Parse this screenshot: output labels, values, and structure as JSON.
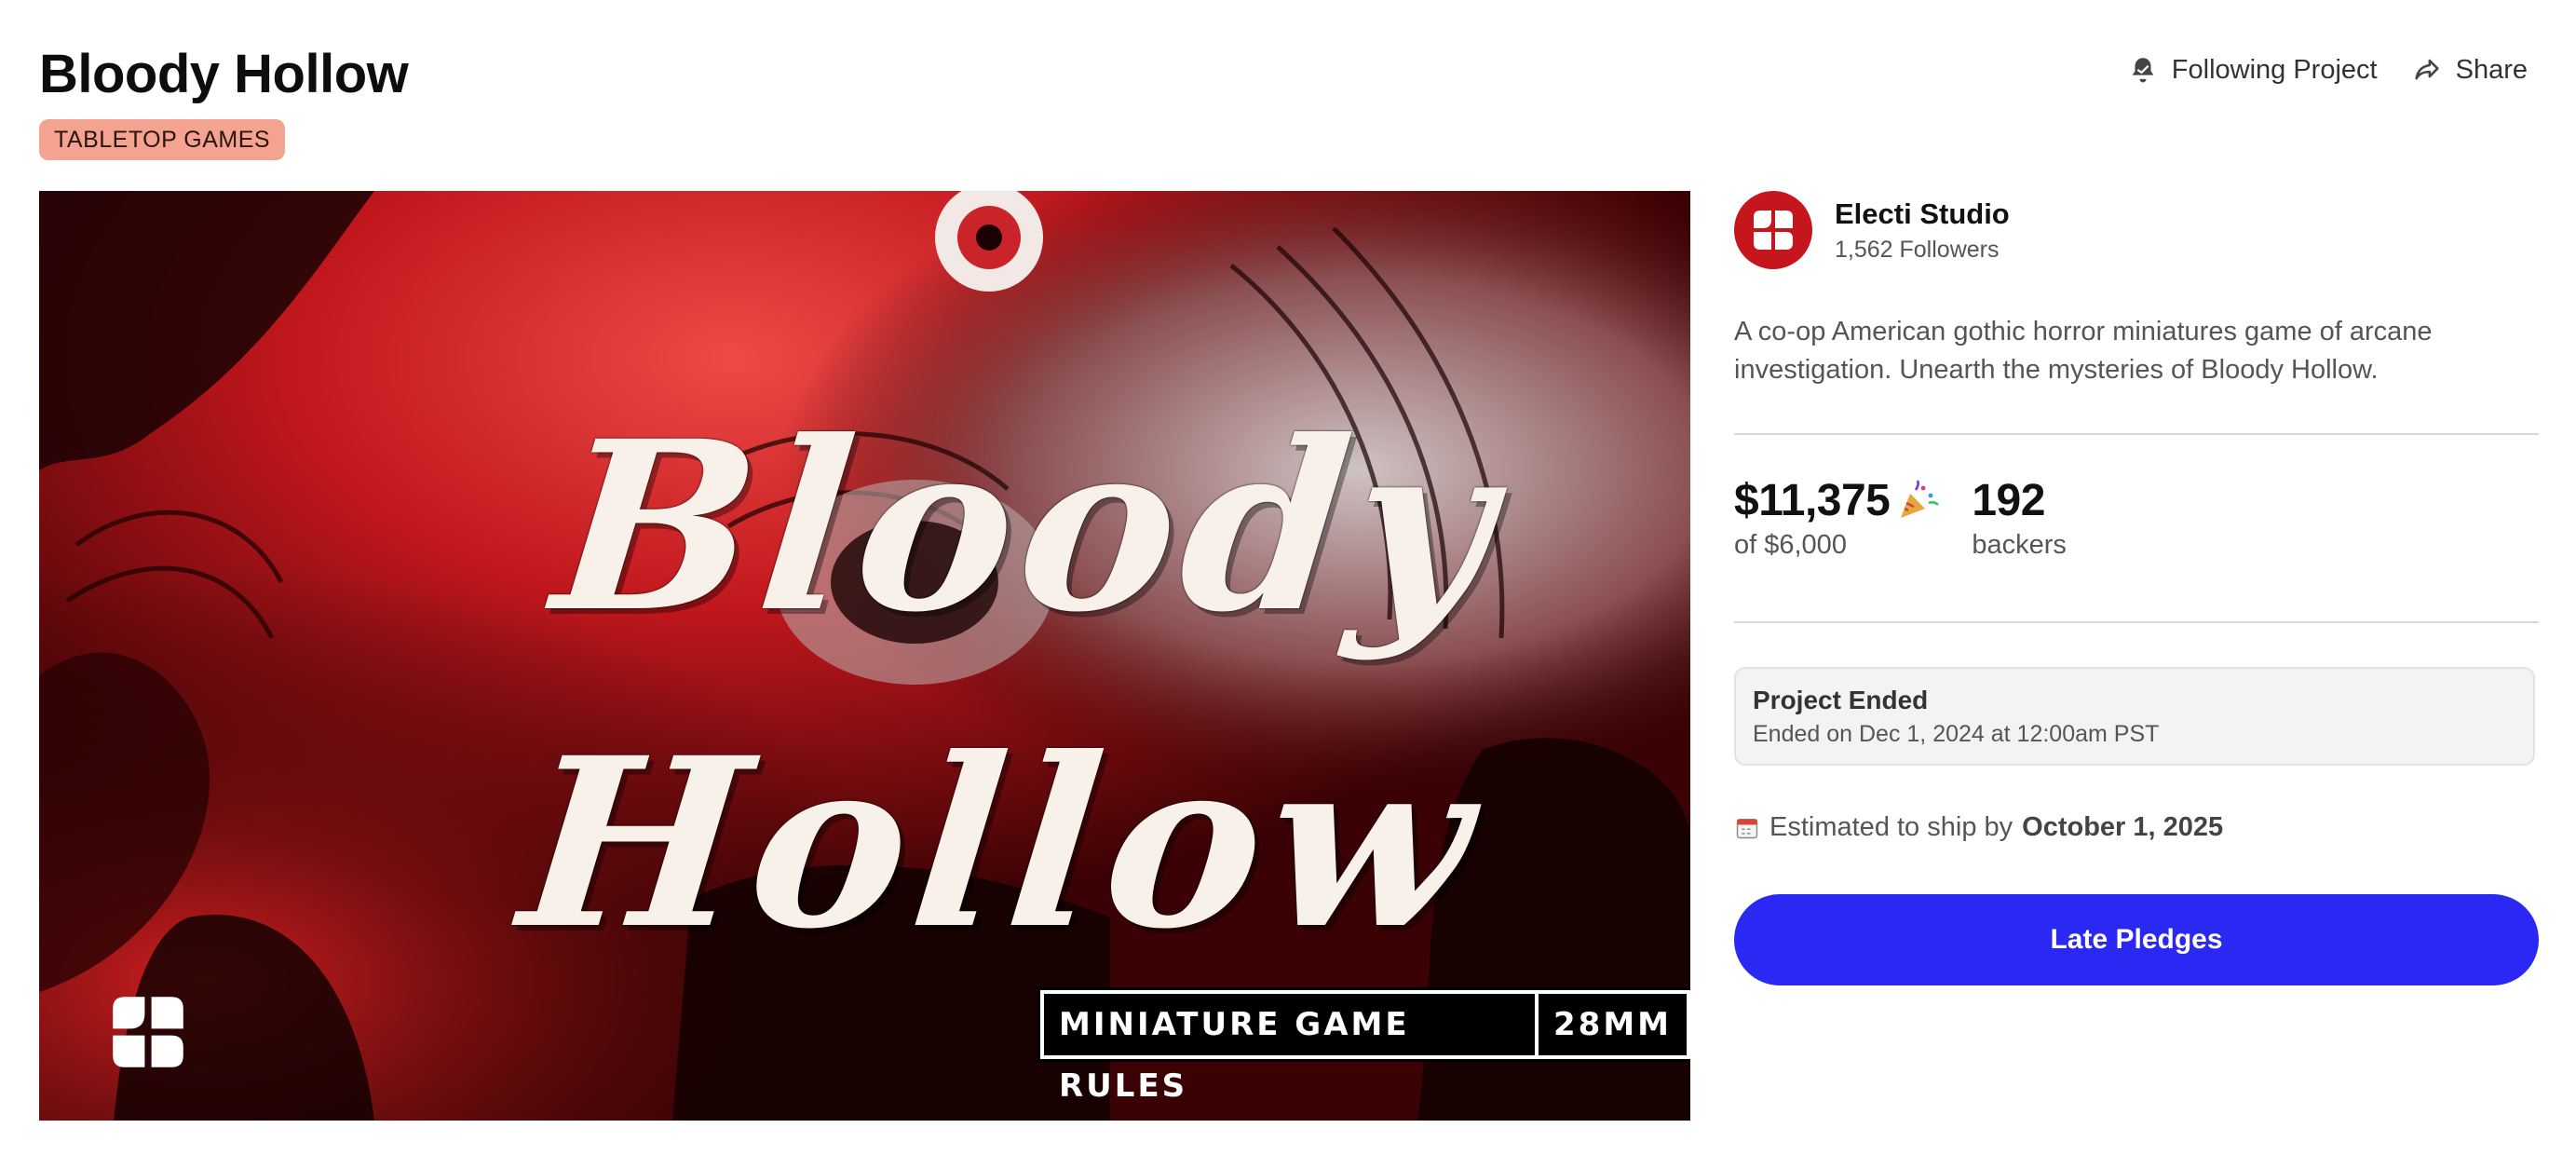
{
  "project": {
    "title": "Bloody Hollow",
    "category": "TABLETOP GAMES"
  },
  "actions": {
    "follow_label": "Following Project",
    "share_label": "Share",
    "follow_icon": "bell-icon",
    "share_icon": "share-arrow-icon"
  },
  "hero": {
    "title_line1": "Bloody",
    "title_line2": "Hollow",
    "badge_rules": "MINIATURE GAME RULES",
    "badge_scale": "28MM",
    "logo_icon": "electi-studio-logo-icon",
    "colors": {
      "primary": "#c5161e",
      "dark": "#1a0203"
    }
  },
  "creator": {
    "name": "Electi Studio",
    "followers": "1,562 Followers"
  },
  "blurb": "A co-op American gothic horror miniatures game of arcane investigation. Unearth the mysteries of Bloody Hollow.",
  "stats": {
    "pledged": "$11,375",
    "pledged_icon": "party-popper-icon",
    "goal": "of $6,000",
    "backers": "192",
    "backers_label": "backers"
  },
  "status": {
    "title": "Project Ended",
    "subtitle": "Ended on Dec 1, 2024 at 12:00am PST"
  },
  "shipping": {
    "icon": "calendar-icon",
    "prefix": "Estimated to ship by",
    "date": "October 1, 2025"
  },
  "cta": {
    "label": "Late Pledges",
    "color": "#2b28f4"
  }
}
